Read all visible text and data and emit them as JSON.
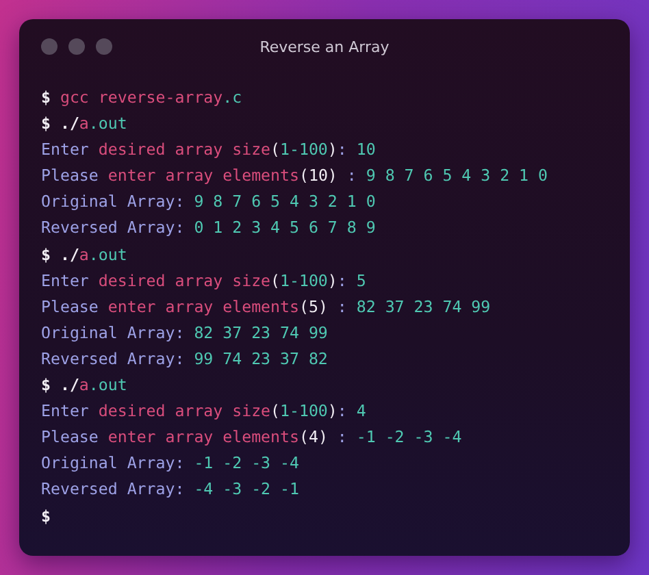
{
  "window": {
    "title": "Reverse an Array"
  },
  "lines": [
    [
      {
        "kind": "prompt",
        "text": "$ "
      },
      {
        "kind": "key",
        "text": "gcc reverse-array"
      },
      {
        "kind": "num",
        "text": ".c"
      }
    ],
    [
      {
        "kind": "prompt",
        "text": "$ ./"
      },
      {
        "kind": "key",
        "text": "a"
      },
      {
        "kind": "num",
        "text": ".out"
      }
    ],
    [
      {
        "kind": "text",
        "text": "Enter "
      },
      {
        "kind": "key",
        "text": "desired array size"
      },
      {
        "kind": "punct",
        "text": "("
      },
      {
        "kind": "num",
        "text": "1-100"
      },
      {
        "kind": "punct",
        "text": ")"
      },
      {
        "kind": "text",
        "text": ": "
      },
      {
        "kind": "num",
        "text": "10"
      }
    ],
    [
      {
        "kind": "text",
        "text": "Please "
      },
      {
        "kind": "key",
        "text": "enter array elements"
      },
      {
        "kind": "punct",
        "text": "(10)"
      },
      {
        "kind": "text",
        "text": " : "
      },
      {
        "kind": "num",
        "text": "9 8 7 6 5 4 3 2 1 0"
      }
    ],
    [
      {
        "kind": "text",
        "text": "Original Array: "
      },
      {
        "kind": "num",
        "text": "9 8 7 6 5 4 3 2 1 0"
      }
    ],
    [
      {
        "kind": "text",
        "text": "Reversed Array: "
      },
      {
        "kind": "num",
        "text": "0 1 2 3 4 5 6 7 8 9"
      }
    ],
    [
      {
        "kind": "prompt",
        "text": "$ ./"
      },
      {
        "kind": "key",
        "text": "a"
      },
      {
        "kind": "num",
        "text": ".out"
      }
    ],
    [
      {
        "kind": "text",
        "text": "Enter "
      },
      {
        "kind": "key",
        "text": "desired array size"
      },
      {
        "kind": "punct",
        "text": "("
      },
      {
        "kind": "num",
        "text": "1-100"
      },
      {
        "kind": "punct",
        "text": ")"
      },
      {
        "kind": "text",
        "text": ": "
      },
      {
        "kind": "num",
        "text": "5"
      }
    ],
    [
      {
        "kind": "text",
        "text": "Please "
      },
      {
        "kind": "key",
        "text": "enter array elements"
      },
      {
        "kind": "punct",
        "text": "(5)"
      },
      {
        "kind": "text",
        "text": " : "
      },
      {
        "kind": "num",
        "text": "82 37 23 74 99"
      }
    ],
    [
      {
        "kind": "text",
        "text": "Original Array: "
      },
      {
        "kind": "num",
        "text": "82 37 23 74 99"
      }
    ],
    [
      {
        "kind": "text",
        "text": "Reversed Array: "
      },
      {
        "kind": "num",
        "text": "99 74 23 37 82"
      }
    ],
    [
      {
        "kind": "prompt",
        "text": "$ ./"
      },
      {
        "kind": "key",
        "text": "a"
      },
      {
        "kind": "num",
        "text": ".out"
      }
    ],
    [
      {
        "kind": "text",
        "text": "Enter "
      },
      {
        "kind": "key",
        "text": "desired array size"
      },
      {
        "kind": "punct",
        "text": "("
      },
      {
        "kind": "num",
        "text": "1-100"
      },
      {
        "kind": "punct",
        "text": ")"
      },
      {
        "kind": "text",
        "text": ": "
      },
      {
        "kind": "num",
        "text": "4"
      }
    ],
    [
      {
        "kind": "text",
        "text": "Please "
      },
      {
        "kind": "key",
        "text": "enter array elements"
      },
      {
        "kind": "punct",
        "text": "(4)"
      },
      {
        "kind": "text",
        "text": " : "
      },
      {
        "kind": "num",
        "text": "-1 -2 -3 -4"
      }
    ],
    [
      {
        "kind": "text",
        "text": "Original Array: "
      },
      {
        "kind": "num",
        "text": "-1 -2 -3 -4"
      }
    ],
    [
      {
        "kind": "text",
        "text": "Reversed Array: "
      },
      {
        "kind": "num",
        "text": "-4 -3 -2 -1"
      }
    ],
    [
      {
        "kind": "prompt",
        "text": "$"
      }
    ]
  ]
}
